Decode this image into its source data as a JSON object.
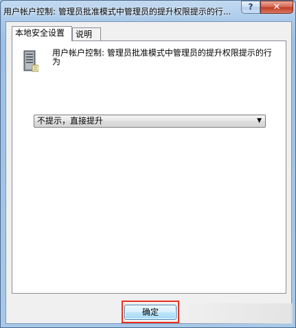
{
  "window": {
    "title": "用户帐户控制: 管理员批准模式中管理员的提升权限提示的行...",
    "help_label": "?",
    "close_label": "✕"
  },
  "tabs": [
    {
      "label": "本地安全设置",
      "active": true
    },
    {
      "label": "说明",
      "active": false
    }
  ],
  "policy": {
    "icon": "server-icon",
    "title": "用户帐户控制: 管理员批准模式中管理员的提升权限提示的行为"
  },
  "dropdown": {
    "selected": "不提示，直接提升"
  },
  "footer": {
    "ok_label": "确定"
  },
  "colors": {
    "highlight": "#e8311e",
    "close": "#c0391f"
  }
}
